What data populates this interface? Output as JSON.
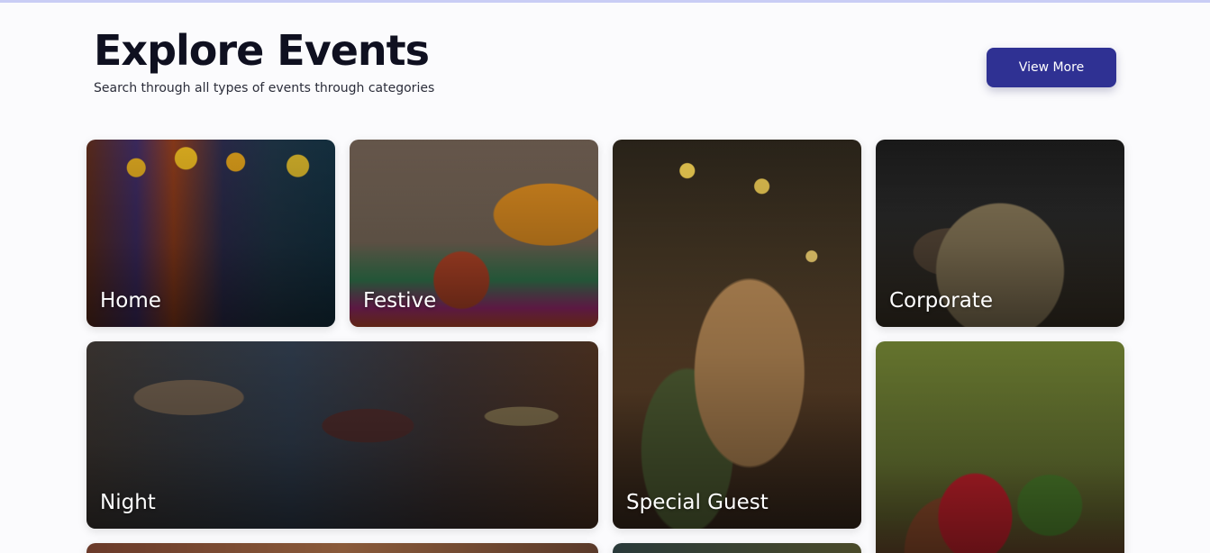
{
  "header": {
    "title": "Explore Events",
    "subtitle": "Search through all types of events through categories",
    "view_more_label": "View More"
  },
  "categories": [
    {
      "label": "Home"
    },
    {
      "label": "Festive"
    },
    {
      "label": "Special Guest"
    },
    {
      "label": "Corporate"
    },
    {
      "label": "Night"
    },
    {
      "label": ""
    },
    {
      "label": ""
    },
    {
      "label": ""
    }
  ],
  "colors": {
    "accent": "#2f3193",
    "title": "#0f1020",
    "background": "#fbfbfd"
  }
}
